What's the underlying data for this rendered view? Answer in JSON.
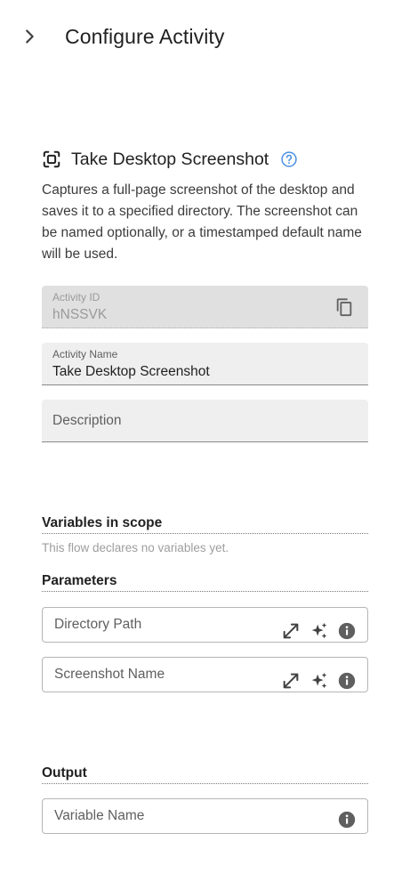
{
  "header": {
    "title": "Configure Activity",
    "toggle_icon": "chevron-right-icon"
  },
  "activity": {
    "icon": "screenshot-frame-icon",
    "title": "Take Desktop Screenshot",
    "help_icon": "help-circle-icon",
    "description": "Captures a full-page screenshot of the desktop and saves it to a specified directory. The screenshot can be named optionally, or a timestamped default name will be used."
  },
  "fields": {
    "activity_id": {
      "label": "Activity ID",
      "value": "hNSSVK",
      "icon": "copy-icon"
    },
    "activity_name": {
      "label": "Activity Name",
      "value": "Take Desktop Screenshot"
    },
    "description": {
      "placeholder": "Description"
    }
  },
  "variables": {
    "title": "Variables in scope",
    "empty_text": "This flow declares no variables yet."
  },
  "parameters": {
    "title": "Parameters",
    "items": [
      {
        "placeholder": "Directory Path",
        "icons": [
          "expand-icon",
          "sparkle-icon",
          "info-icon"
        ]
      },
      {
        "placeholder": "Screenshot Name",
        "icons": [
          "expand-icon",
          "sparkle-icon",
          "info-icon"
        ]
      }
    ]
  },
  "output": {
    "title": "Output",
    "placeholder": "Variable Name",
    "icon": "info-icon"
  },
  "colors": {
    "help": "#4a90e2",
    "icon": "#424242",
    "field_bg": "#efefef",
    "field_disabled_bg": "#e0e0e0"
  }
}
